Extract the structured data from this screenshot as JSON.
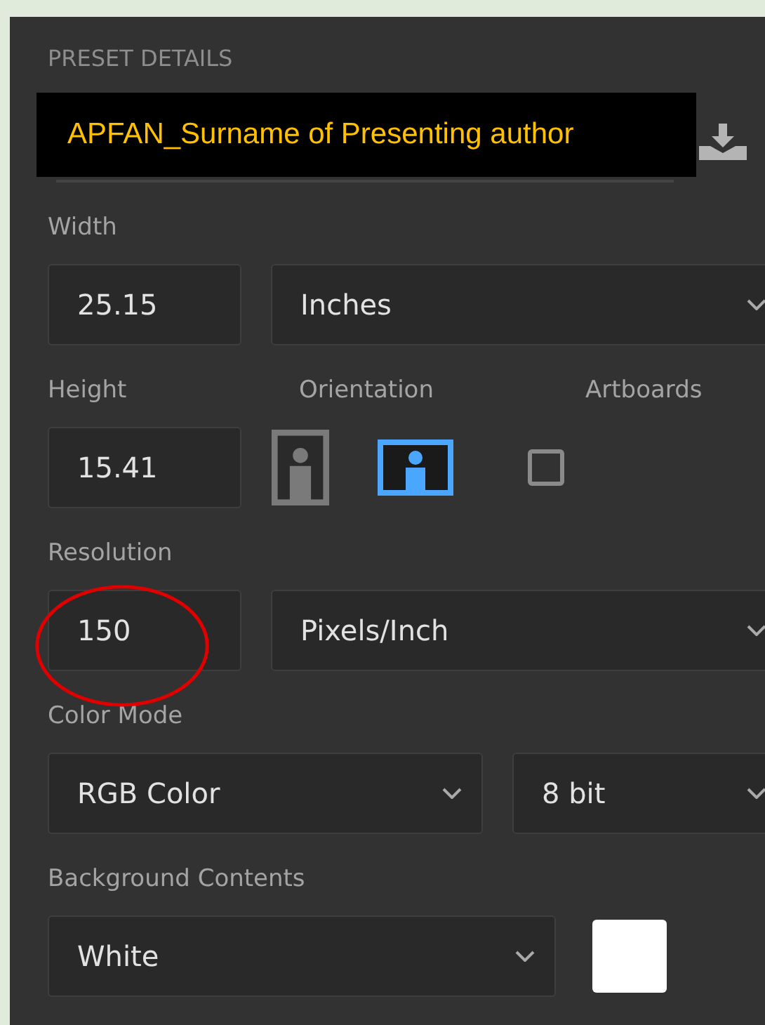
{
  "section_title": "PRESET DETAILS",
  "name_banner": "APFAN_Surname of Presenting author",
  "width": {
    "label": "Width",
    "value": "25.15",
    "unit": "Inches"
  },
  "height": {
    "label": "Height",
    "value": "15.41"
  },
  "orientation": {
    "label": "Orientation",
    "options": [
      {
        "kind": "portrait",
        "selected": false
      },
      {
        "kind": "landscape",
        "selected": true
      }
    ]
  },
  "artboards": {
    "label": "Artboards",
    "checked": false
  },
  "resolution": {
    "label": "Resolution",
    "value": "150",
    "unit": "Pixels/Inch",
    "circled": true
  },
  "color_mode": {
    "label": "Color Mode",
    "mode": "RGB Color",
    "depth": "8 bit"
  },
  "background": {
    "label": "Background Contents",
    "value": "White"
  }
}
